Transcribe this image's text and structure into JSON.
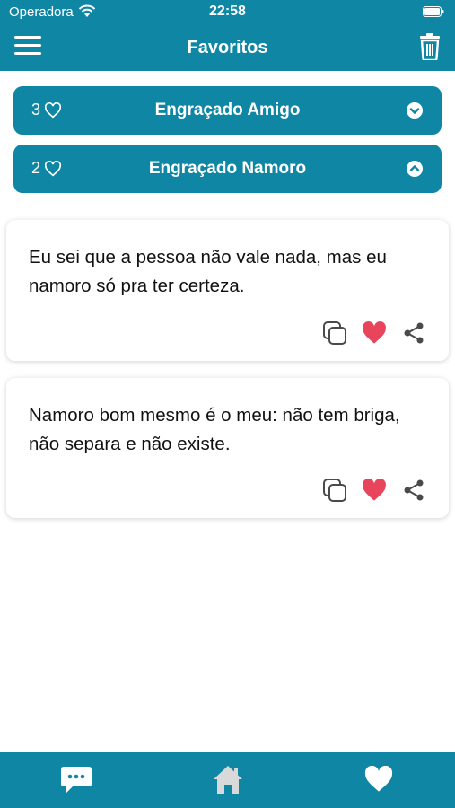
{
  "status_bar": {
    "carrier": "Operadora",
    "time": "22:58"
  },
  "nav": {
    "title": "Favoritos",
    "menu_icon": "hamburger-menu-icon",
    "trash_icon": "trash-icon"
  },
  "categories": [
    {
      "count": "3",
      "label": "Engraçado Amigo",
      "expanded": false
    },
    {
      "count": "2",
      "label": "Engraçado Namoro",
      "expanded": true
    }
  ],
  "quotes": [
    {
      "text": "Eu sei que a pessoa não vale nada, mas eu namoro só pra ter certeza.",
      "favorited": true
    },
    {
      "text": "Namoro bom mesmo é o meu: não tem briga, não separa e não existe.",
      "favorited": true
    }
  ],
  "tabs": [
    {
      "name": "messages",
      "icon": "chat-bubble-icon"
    },
    {
      "name": "home",
      "icon": "home-icon"
    },
    {
      "name": "favorites",
      "icon": "heart-icon"
    }
  ],
  "colors": {
    "primary": "#0f86a4",
    "heart": "#e8455d",
    "icon_gray": "#4a4a4a"
  }
}
